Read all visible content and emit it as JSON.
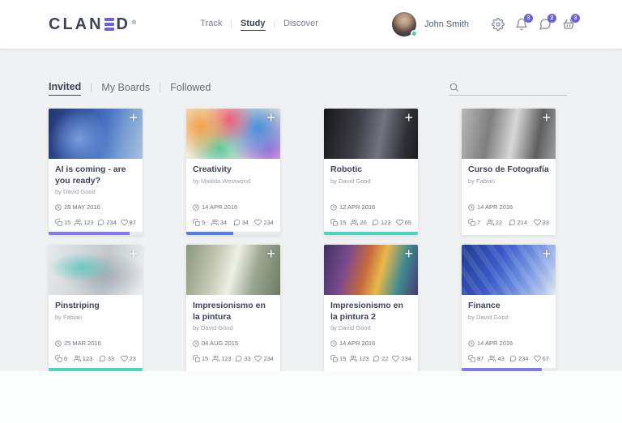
{
  "header": {
    "logo": {
      "part1": "CLAN",
      "part2": "D",
      "registered": "®"
    },
    "nav": [
      {
        "label": "Track",
        "active": false
      },
      {
        "label": "Study",
        "active": true
      },
      {
        "label": "Discover",
        "active": false
      }
    ],
    "user": {
      "name": "John Smith",
      "status": "online"
    },
    "actions": [
      {
        "name": "settings",
        "icon": "gear-icon",
        "badge": ""
      },
      {
        "name": "notifications",
        "icon": "bell-icon",
        "badge": "3"
      },
      {
        "name": "messages",
        "icon": "chat-icon",
        "badge": "2"
      },
      {
        "name": "basket",
        "icon": "basket-icon",
        "badge": "3"
      }
    ]
  },
  "tabs": [
    {
      "label": "Invited",
      "active": true
    },
    {
      "label": "My Boards",
      "active": false
    },
    {
      "label": "Followed",
      "active": false
    }
  ],
  "search": {
    "placeholder": "",
    "value": ""
  },
  "colors": {
    "accent_purple": "#6a62dd",
    "progress_purple": "#8379e6",
    "progress_blue": "#5b7de8",
    "progress_teal": "#4fd4c4"
  },
  "cards": [
    {
      "title": "AI is coming - are you ready?",
      "author": "by David Good",
      "date": "28 MAY 2016",
      "docs": "15",
      "members": "123",
      "comments": "234",
      "likes": "87",
      "image": "ai",
      "progress": 86,
      "progress_color": "#8379e6"
    },
    {
      "title": "Creativity",
      "author": "by Matilda Westwood",
      "date": "14 APR 2016",
      "docs": "5",
      "members": "34",
      "comments": "34",
      "likes": "234",
      "image": "creativity",
      "progress": 50,
      "progress_color": "#5b7de8"
    },
    {
      "title": "Robotic",
      "author": "by David Good",
      "date": "12 APR 2016",
      "docs": "15",
      "members": "26",
      "comments": "123",
      "likes": "65",
      "image": "robotic",
      "progress": 100,
      "progress_color": "#4fd4c4"
    },
    {
      "title": "Curso de Fotografía",
      "author": "by Fabian",
      "date": "14 APR 2016",
      "docs": "7",
      "members": "22",
      "comments": "214",
      "likes": "33",
      "image": "photography",
      "progress": 0,
      "progress_color": ""
    },
    {
      "title": "Pinstriping",
      "author": "by Fabian",
      "date": "25 MAR 2016",
      "docs": "6",
      "members": "123",
      "comments": "33",
      "likes": "23",
      "image": "pinstriping",
      "progress": 100,
      "progress_color": "#4fd4c4"
    },
    {
      "title": "Impresionismo en la pintura",
      "author": "by David Good",
      "date": "04 AUG 2015",
      "docs": "15",
      "members": "123",
      "comments": "33",
      "likes": "234",
      "image": "impressionism-1",
      "progress": 0,
      "progress_color": ""
    },
    {
      "title": "Impresionismo en la pintura 2",
      "author": "by David Good",
      "date": "14 APR 2016",
      "docs": "15",
      "members": "123",
      "comments": "22",
      "likes": "234",
      "image": "impressionism-2",
      "progress": 0,
      "progress_color": ""
    },
    {
      "title": "Finance",
      "author": "by David Good",
      "date": "14 APR 2016",
      "docs": "87",
      "members": "43",
      "comments": "234",
      "likes": "67",
      "image": "finance",
      "progress": 85,
      "progress_color": "#8379e6"
    }
  ]
}
